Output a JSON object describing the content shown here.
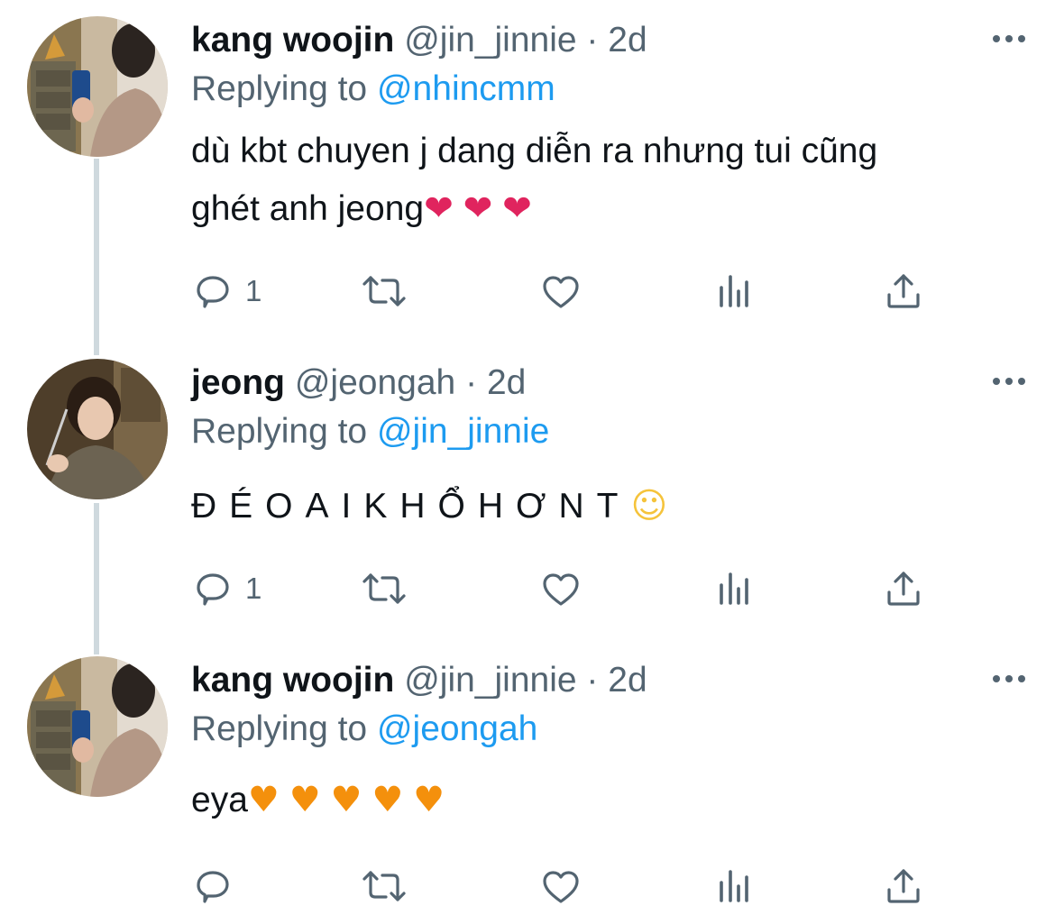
{
  "tweets": [
    {
      "name": "kang woojin",
      "handle": "@jin_jinnie",
      "separator": "·",
      "time": "2d",
      "replying_prefix": "Replying to",
      "replying_to": "@nhincmm",
      "text_line1": "dù kbt chuyen j dang diễn ra nhưng tui cũng",
      "text_line2": "ghét anh jeong",
      "emojis": [
        "❤",
        "❤",
        "❤"
      ],
      "reply_count": "1"
    },
    {
      "name": "jeong",
      "handle": "@jeongah",
      "separator": "·",
      "time": "2d",
      "replying_prefix": "Replying to",
      "replying_to": "@jin_jinnie",
      "text_line1": "ĐÉOAIKHỔHƠNT",
      "emojis": [
        "☺"
      ],
      "reply_count": "1"
    },
    {
      "name": "kang woojin",
      "handle": "@jin_jinnie",
      "separator": "·",
      "time": "2d",
      "replying_prefix": "Replying to",
      "replying_to": "@jeongah",
      "text_line1": "eya",
      "emojis": [
        "♥",
        "♥",
        "♥",
        "♥",
        "♥"
      ],
      "reply_count": ""
    }
  ],
  "icons": {
    "more": "more-horizontal-icon",
    "reply": "reply-icon",
    "retweet": "retweet-icon",
    "like": "like-icon",
    "views": "analytics-icon",
    "share": "share-icon"
  },
  "colors": {
    "link": "#1d9bf0",
    "secondary_text": "#536471",
    "primary_text": "#0f1419",
    "thread_line": "#cfd9de",
    "heart_red": "#e0245e",
    "heart_orange": "#f4900c"
  }
}
